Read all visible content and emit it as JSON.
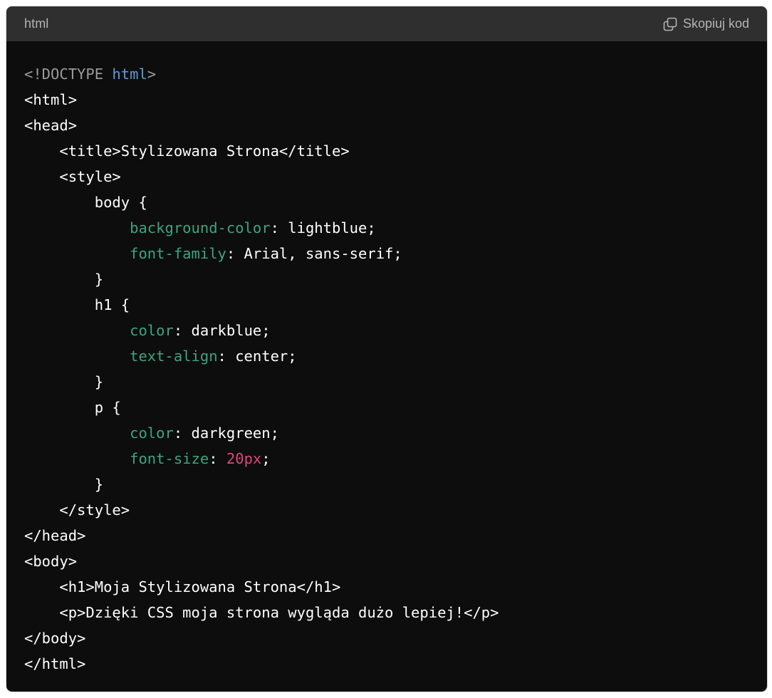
{
  "header": {
    "language": "html",
    "copy_label": "Skopiuj kod",
    "copy_icon": "copy-icon"
  },
  "colors": {
    "background": "#0d0d0d",
    "header_background": "#2f2f2f",
    "plain_text": "#ffffff",
    "doctype": "#9b9b9b",
    "doctype_keyword": "#5b9bd5",
    "css_property": "#3ba57f",
    "number": "#e0457b"
  },
  "code_lines": [
    [
      {
        "t": "comment",
        "v": "<!DOCTYPE "
      },
      {
        "t": "keyword",
        "v": "html"
      },
      {
        "t": "comment",
        "v": ">"
      }
    ],
    [
      {
        "t": "plain",
        "v": "<html>"
      }
    ],
    [
      {
        "t": "plain",
        "v": "<head>"
      }
    ],
    [
      {
        "t": "plain",
        "v": "    <title>Stylizowana Strona</title>"
      }
    ],
    [
      {
        "t": "plain",
        "v": "    <style>"
      }
    ],
    [
      {
        "t": "plain",
        "v": "        body {"
      }
    ],
    [
      {
        "t": "plain",
        "v": "            "
      },
      {
        "t": "attr",
        "v": "background-color"
      },
      {
        "t": "plain",
        "v": ": lightblue;"
      }
    ],
    [
      {
        "t": "plain",
        "v": "            "
      },
      {
        "t": "attr",
        "v": "font-family"
      },
      {
        "t": "plain",
        "v": ": Arial, sans-serif;"
      }
    ],
    [
      {
        "t": "plain",
        "v": "        }"
      }
    ],
    [
      {
        "t": "plain",
        "v": "        h1 {"
      }
    ],
    [
      {
        "t": "plain",
        "v": "            "
      },
      {
        "t": "attr",
        "v": "color"
      },
      {
        "t": "plain",
        "v": ": darkblue;"
      }
    ],
    [
      {
        "t": "plain",
        "v": "            "
      },
      {
        "t": "attr",
        "v": "text-align"
      },
      {
        "t": "plain",
        "v": ": center;"
      }
    ],
    [
      {
        "t": "plain",
        "v": "        }"
      }
    ],
    [
      {
        "t": "plain",
        "v": "        p {"
      }
    ],
    [
      {
        "t": "plain",
        "v": "            "
      },
      {
        "t": "attr",
        "v": "color"
      },
      {
        "t": "plain",
        "v": ": darkgreen;"
      }
    ],
    [
      {
        "t": "plain",
        "v": "            "
      },
      {
        "t": "attr",
        "v": "font-size"
      },
      {
        "t": "plain",
        "v": ": "
      },
      {
        "t": "number",
        "v": "20px"
      },
      {
        "t": "plain",
        "v": ";"
      }
    ],
    [
      {
        "t": "plain",
        "v": "        }"
      }
    ],
    [
      {
        "t": "plain",
        "v": "    </style>"
      }
    ],
    [
      {
        "t": "plain",
        "v": "</head>"
      }
    ],
    [
      {
        "t": "plain",
        "v": "<body>"
      }
    ],
    [
      {
        "t": "plain",
        "v": "    <h1>Moja Stylizowana Strona</h1>"
      }
    ],
    [
      {
        "t": "plain",
        "v": "    <p>Dzięki CSS moja strona wygląda dużo lepiej!</p>"
      }
    ],
    [
      {
        "t": "plain",
        "v": "</body>"
      }
    ],
    [
      {
        "t": "plain",
        "v": "</html>"
      }
    ]
  ]
}
